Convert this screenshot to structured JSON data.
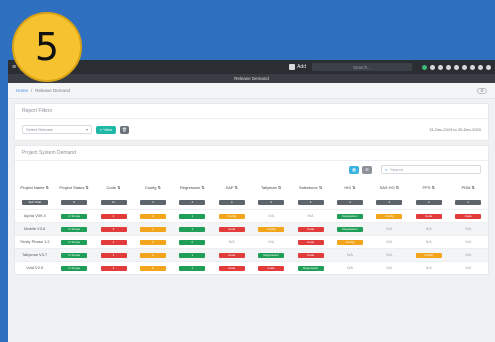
{
  "step_badge": "5",
  "topbar": {
    "add_label": "Add",
    "search_placeholder": "Search..."
  },
  "window_title": "Release Demand",
  "breadcrumb": {
    "home": "Home",
    "current": "Release Demand"
  },
  "report_filters": {
    "heading": "Report Filters",
    "release_placeholder": "Select Release",
    "view_label": "View",
    "date_range": "31-Dec-2019 to 30-Dec-2020"
  },
  "demand": {
    "heading": "Project System Demand",
    "search_placeholder": "Search",
    "columns": [
      "Project Name",
      "Project Status",
      "Code",
      "Config",
      "Regression",
      "SAP",
      "Tallyman",
      "Salesforce",
      "HIS",
      "SAS HO",
      "PPS",
      "PDM"
    ],
    "totals_label": "Sub Total",
    "totals": [
      "6",
      "11",
      "4",
      "4",
      "4",
      "4",
      "4",
      "4",
      "2",
      "2",
      "2"
    ],
    "rows": [
      {
        "name": "Alpha V09.3",
        "status": "In Scope",
        "cells": [
          [
            "red",
            "2"
          ],
          [
            "orange",
            "2"
          ],
          [
            "green",
            "1"
          ],
          [
            "orange",
            "Config"
          ],
          [
            "na",
            "N/A"
          ],
          [
            "na",
            "N/A"
          ],
          [
            "green",
            "Regression"
          ],
          [
            "orange",
            "Config"
          ],
          [
            "red",
            "Code"
          ],
          [
            "red",
            "Code"
          ]
        ]
      },
      {
        "name": "Mobile V3.6",
        "status": "In Scope",
        "cells": [
          [
            "red",
            "3"
          ],
          [
            "orange",
            "1"
          ],
          [
            "green",
            "1"
          ],
          [
            "red",
            "Code"
          ],
          [
            "orange",
            "Config"
          ],
          [
            "red",
            "Code"
          ],
          [
            "green",
            "Regression"
          ],
          [
            "na",
            "N/A"
          ],
          [
            "na",
            "N/A"
          ],
          [
            "na",
            "N/A"
          ]
        ]
      },
      {
        "name": "Trinity Phase 1.2",
        "status": "In Scope",
        "cells": [
          [
            "red",
            "1"
          ],
          [
            "orange",
            "1"
          ],
          [
            "green",
            "0"
          ],
          [
            "na",
            "N/A"
          ],
          [
            "na",
            "N/A"
          ],
          [
            "red",
            "Code"
          ],
          [
            "orange",
            "Config"
          ],
          [
            "na",
            "N/A"
          ],
          [
            "na",
            "N/A"
          ],
          [
            "na",
            "N/A"
          ]
        ]
      },
      {
        "name": "Tallyman V3.7",
        "status": "In Scope",
        "cells": [
          [
            "red",
            "1"
          ],
          [
            "orange",
            "1"
          ],
          [
            "green",
            "1"
          ],
          [
            "red",
            "Code"
          ],
          [
            "green",
            "Regression"
          ],
          [
            "red",
            "Code"
          ],
          [
            "na",
            "N/A"
          ],
          [
            "na",
            "N/A"
          ],
          [
            "orange",
            "Config"
          ],
          [
            "na",
            "N/A"
          ]
        ]
      },
      {
        "name": "Void V2.9",
        "status": "In Scope",
        "cells": [
          [
            "red",
            "4"
          ],
          [
            "orange",
            "0"
          ],
          [
            "green",
            "1"
          ],
          [
            "red",
            "Code"
          ],
          [
            "red",
            "Code"
          ],
          [
            "green",
            "Regression"
          ],
          [
            "na",
            "N/A"
          ],
          [
            "na",
            "N/A"
          ],
          [
            "na",
            "N/A"
          ],
          [
            "na",
            "N/A"
          ]
        ]
      }
    ]
  },
  "colors": {
    "code": "#e23b3b",
    "config": "#f2a51a",
    "regression": "#1e9e57",
    "total": "#5d646c",
    "accent": "#1fb8a6"
  }
}
